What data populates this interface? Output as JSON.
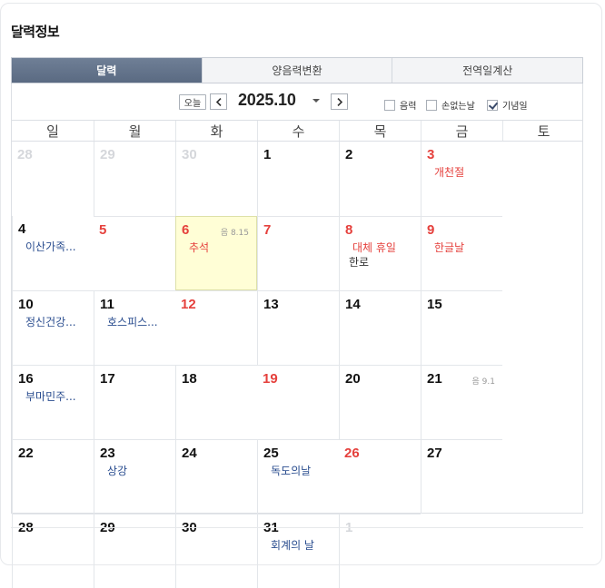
{
  "title": "달력정보",
  "tabs": [
    {
      "label": "달력",
      "active": true
    },
    {
      "label": "양음력변환",
      "active": false
    },
    {
      "label": "전역일계산",
      "active": false
    }
  ],
  "toolbar": {
    "today_label": "오늘",
    "month": "2025.10",
    "options": {
      "lunar": {
        "label": "음력",
        "checked": false
      },
      "noson": {
        "label": "손없는날",
        "checked": false
      },
      "anniv": {
        "label": "기념일",
        "checked": true
      }
    }
  },
  "weekdays": [
    "일",
    "월",
    "화",
    "수",
    "목",
    "금",
    "토"
  ],
  "colors": {
    "holiday": "#e5403c",
    "event": "#2a4d8f",
    "today_bg": "#fffed6",
    "tab_active": "#5f6f87"
  },
  "days": [
    {
      "d": "28",
      "other": true
    },
    {
      "d": "29",
      "other": true
    },
    {
      "d": "30",
      "other": true
    },
    {
      "d": "1"
    },
    {
      "d": "2"
    },
    {
      "d": "3",
      "red": true,
      "events": [
        {
          "t": "개천절",
          "c": "red"
        }
      ]
    },
    {
      "d": "4",
      "events": [
        {
          "t": "이산가족...",
          "c": "blue"
        }
      ]
    },
    {
      "d": "5",
      "red": true
    },
    {
      "d": "6",
      "red": true,
      "today": true,
      "lunar": "음 8.15",
      "events": [
        {
          "t": "추석",
          "c": "red"
        }
      ]
    },
    {
      "d": "7",
      "red": true
    },
    {
      "d": "8",
      "red": true,
      "events": [
        {
          "t": "대체 휴일",
          "c": "red"
        },
        {
          "t": "한로",
          "c": "plain"
        }
      ]
    },
    {
      "d": "9",
      "red": true,
      "events": [
        {
          "t": "한글날",
          "c": "red"
        }
      ]
    },
    {
      "d": "10",
      "events": [
        {
          "t": "정신건강...",
          "c": "blue"
        }
      ]
    },
    {
      "d": "11",
      "events": [
        {
          "t": "호스피스...",
          "c": "blue"
        }
      ]
    },
    {
      "d": "12",
      "red": true
    },
    {
      "d": "13"
    },
    {
      "d": "14"
    },
    {
      "d": "15"
    },
    {
      "d": "16",
      "events": [
        {
          "t": "부마민주...",
          "c": "blue"
        }
      ]
    },
    {
      "d": "17"
    },
    {
      "d": "18"
    },
    {
      "d": "19",
      "red": true
    },
    {
      "d": "20"
    },
    {
      "d": "21",
      "lunar": "음 9.1"
    },
    {
      "d": "22"
    },
    {
      "d": "23",
      "events": [
        {
          "t": "상강",
          "c": "blue"
        }
      ]
    },
    {
      "d": "24"
    },
    {
      "d": "25",
      "events": [
        {
          "t": "독도의날",
          "c": "blue"
        }
      ]
    },
    {
      "d": "26",
      "red": true
    },
    {
      "d": "27"
    },
    {
      "d": "28"
    },
    {
      "d": "29"
    },
    {
      "d": "30"
    },
    {
      "d": "31",
      "events": [
        {
          "t": "회계의 날",
          "c": "blue"
        }
      ]
    },
    {
      "d": "1",
      "other": true
    }
  ]
}
